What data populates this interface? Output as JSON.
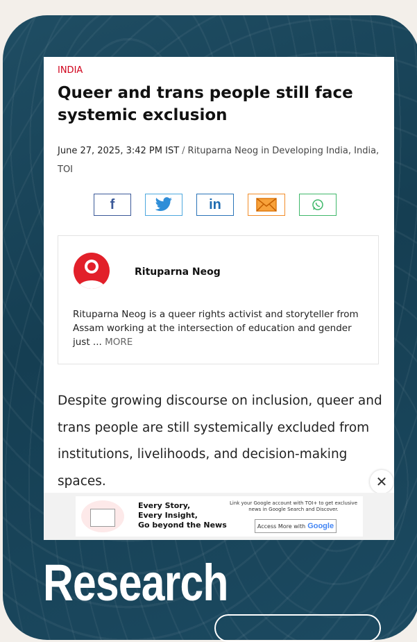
{
  "article": {
    "section": "INDIA",
    "headline": "Queer and trans people still face systemic exclusion",
    "date": "June 27, 2025, 3:42 PM IST",
    "separator": "/",
    "byline": "Rituparna Neog in Developing India, India, TOI"
  },
  "share": {
    "facebook": "f",
    "linkedin": "in",
    "icons": [
      "facebook-icon",
      "twitter-icon",
      "linkedin-icon",
      "email-icon",
      "whatsapp-icon"
    ]
  },
  "author": {
    "name": "Rituparna Neog",
    "bio": "Rituparna Neog is a queer rights activist and storyteller from Assam working at the intersection of education and gender just ...",
    "more": "MORE"
  },
  "body": {
    "paragraph": "Despite growing discourse on inclusion, queer and trans people are still systemically excluded from institutions, livelihoods, and decision-making spaces."
  },
  "close_symbol": "✕",
  "ad": {
    "line1": "Every Story,",
    "line2": "Every Insight,",
    "line3": "Go beyond the News",
    "right_text": "Link your Google account with TOI+ to get exclusive news in Google Search and Discover.",
    "cta_label": "Access More with",
    "cta_brand": "Google"
  },
  "overlay": {
    "title": "Research"
  },
  "colors": {
    "accent_red": "#d0021b",
    "background_teal": "#1f4d63"
  }
}
